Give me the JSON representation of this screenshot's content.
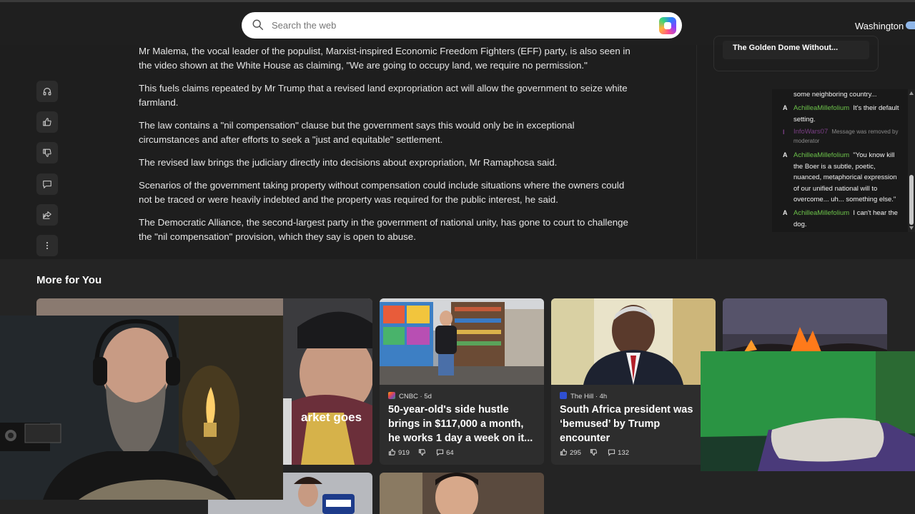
{
  "search": {
    "placeholder": "Search the web"
  },
  "header": {
    "location": "Washington"
  },
  "rail": {
    "items": [
      "listen",
      "like",
      "dislike",
      "comment",
      "share",
      "more"
    ]
  },
  "article": {
    "paragraphs": [
      "Mr Malema, the vocal leader of the populist, Marxist-inspired Economic Freedom Fighters (EFF) party, is also seen in the video shown at the White House as claiming, \"We are going to occupy land, we require no permission.\"",
      "This fuels claims repeated by Mr Trump that a revised land expropriation act will allow the government to seize white farmland.",
      "The law contains a \"nil compensation\" clause but the government says this would only be in exceptional circumstances and after efforts to seek a \"just and equitable\" settlement.",
      "The revised law brings the judiciary directly into decisions about expropriation, Mr Ramaphosa said.",
      "Scenarios of the government taking property without compensation could include situations where the owners could not be traced or were heavily indebted and the property was required for the public interest, he said.",
      "The Democratic Alliance, the second-largest party in the government of national unity, has gone to court to challenge the \"nil compensation\" provision, which they say is open to abuse."
    ]
  },
  "right_card": {
    "title": "The Golden Dome Without..."
  },
  "chat": {
    "badge": "A",
    "badge_mod": "I",
    "messages": [
      {
        "user": "",
        "text": "some neighboring country..."
      },
      {
        "user": "AchilleaMillefolium",
        "text": "It's their default setting."
      },
      {
        "user": "InfoWars07",
        "text": "Message was removed by moderator"
      },
      {
        "user": "AchilleaMillefolium",
        "text": "\"You know kill the Boer is a subtle, poetic, nuanced, metaphorical expression of our unified national will to overcome... uh... something else.\""
      },
      {
        "user": "AchilleaMillefolium",
        "text": "I can't hear the dog."
      }
    ]
  },
  "more": {
    "title": "More for You",
    "cards": [
      {
        "headline_fragment": "arket goes"
      },
      {
        "source": "CNBC · 5d",
        "headline": "50-year-old's side hustle brings in $117,000 a month, he works 1 day a week on it...",
        "likes": "919",
        "comments": "64"
      },
      {
        "source": "The Hill · 4h",
        "headline": "South Africa president was ‘bemused’ by Trump encounter",
        "likes": "295",
        "comments": "132"
      }
    ]
  },
  "colors": {
    "accent_green": "#6cc24a",
    "background": "#1e1e1e",
    "card": "#2d2d2d"
  }
}
